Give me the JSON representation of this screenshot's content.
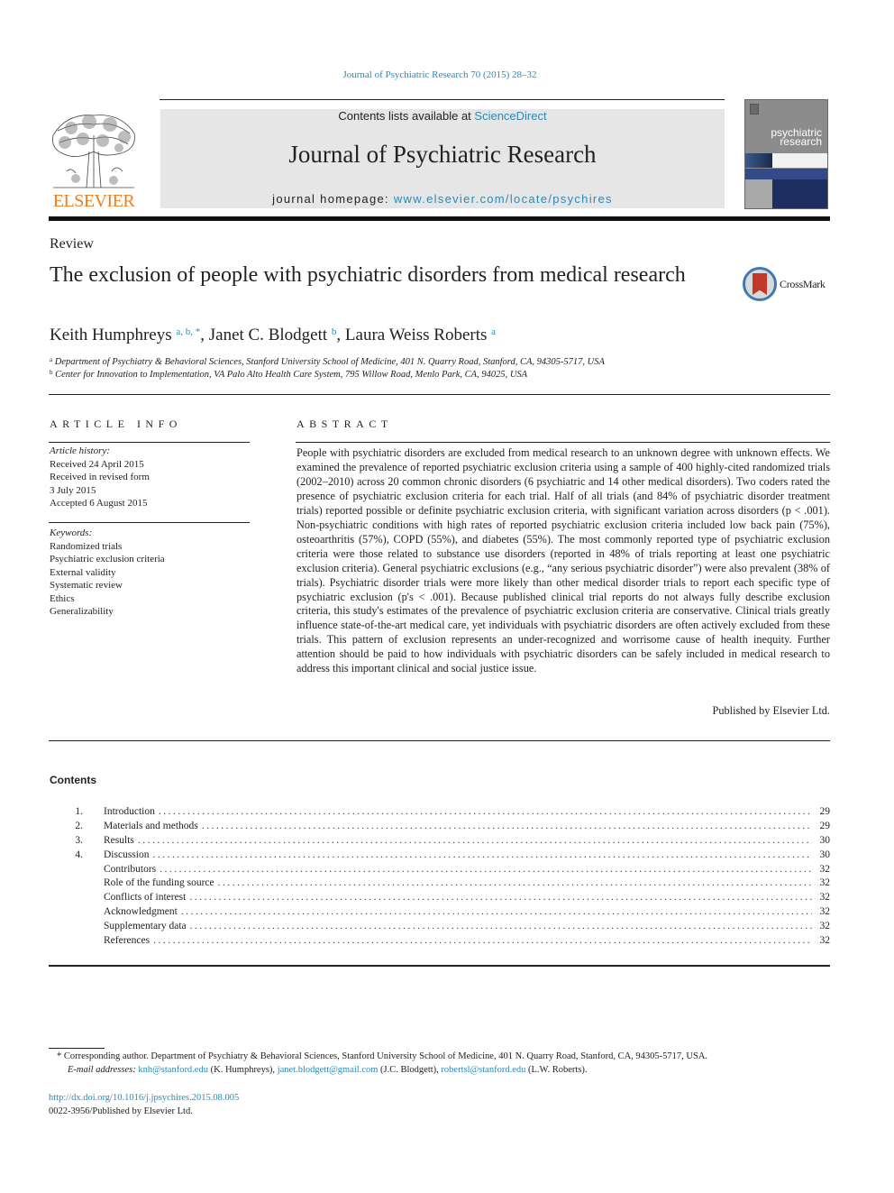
{
  "running_head": "Journal of Psychiatric Research 70 (2015) 28–32",
  "banner": {
    "contents_prefix": "Contents lists available at ",
    "contents_link": "ScienceDirect",
    "journal_name": "Journal of Psychiatric Research",
    "homepage_prefix": "journal homepage: ",
    "homepage_link": "www.elsevier.com/locate/psychires"
  },
  "publisher_logo": "ELSEVIER",
  "cover": {
    "title_line1": "psychiatric",
    "title_line2": "research"
  },
  "crossmark_label": "CrossMark",
  "article_type": "Review",
  "title": "The exclusion of people with psychiatric disorders from medical research",
  "authors": [
    {
      "name": "Keith Humphreys",
      "sup": "a, b, *",
      "sep": ", "
    },
    {
      "name": "Janet C. Blodgett",
      "sup": "b",
      "sep": ", "
    },
    {
      "name": "Laura Weiss Roberts",
      "sup": "a",
      "sep": ""
    }
  ],
  "affiliations": [
    {
      "mark": "a",
      "text": "Department of Psychiatry & Behavioral Sciences, Stanford University School of Medicine, 401 N. Quarry Road, Stanford, CA, 94305-5717, USA"
    },
    {
      "mark": "b",
      "text": "Center for Innovation to Implementation, VA Palo Alto Health Care System, 795 Willow Road, Menlo Park, CA, 94025, USA"
    }
  ],
  "article_info": {
    "heading": "ARTICLE INFO",
    "history_label": "Article history:",
    "history": [
      "Received 24 April 2015",
      "Received in revised form",
      "3 July 2015",
      "Accepted 6 August 2015"
    ],
    "keywords_label": "Keywords:",
    "keywords": [
      "Randomized trials",
      "Psychiatric exclusion criteria",
      "External validity",
      "Systematic review",
      "Ethics",
      "Generalizability"
    ]
  },
  "abstract": {
    "heading": "ABSTRACT",
    "text": "People with psychiatric disorders are excluded from medical research to an unknown degree with unknown effects. We examined the prevalence of reported psychiatric exclusion criteria using a sample of 400 highly-cited randomized trials (2002–2010) across 20 common chronic disorders (6 psychiatric and 14 other medical disorders). Two coders rated the presence of psychiatric exclusion criteria for each trial. Half of all trials (and 84% of psychiatric disorder treatment trials) reported possible or definite psychiatric exclusion criteria, with significant variation across disorders (p < .001). Non-psychiatric conditions with high rates of reported psychiatric exclusion criteria included low back pain (75%), osteoarthritis (57%), COPD (55%), and diabetes (55%). The most commonly reported type of psychiatric exclusion criteria were those related to substance use disorders (reported in 48% of trials reporting at least one psychiatric exclusion criteria). General psychiatric exclusions (e.g., “any serious psychiatric disorder”) were also prevalent (38% of trials). Psychiatric disorder trials were more likely than other medical disorder trials to report each specific type of psychiatric exclusion (p's < .001). Because published clinical trial reports do not always fully describe exclusion criteria, this study's estimates of the prevalence of psychiatric exclusion criteria are conservative. Clinical trials greatly influence state-of-the-art medical care, yet individuals with psychiatric disorders are often actively excluded from these trials. This pattern of exclusion represents an under-recognized and worrisome cause of health inequity. Further attention should be paid to how individuals with psychiatric disorders can be safely included in medical research to address this important clinical and social justice issue.",
    "published_by": "Published by Elsevier Ltd."
  },
  "contents": {
    "heading": "Contents",
    "items": [
      {
        "num": "1.",
        "label": "Introduction",
        "page": "29"
      },
      {
        "num": "2.",
        "label": "Materials and methods",
        "page": "29"
      },
      {
        "num": "3.",
        "label": "Results",
        "page": "30"
      },
      {
        "num": "4.",
        "label": "Discussion",
        "page": "30"
      },
      {
        "num": "",
        "label": "Contributors",
        "page": "32"
      },
      {
        "num": "",
        "label": "Role of the funding source",
        "page": "32"
      },
      {
        "num": "",
        "label": "Conflicts of interest",
        "page": "32"
      },
      {
        "num": "",
        "label": "Acknowledgment",
        "page": "32"
      },
      {
        "num": "",
        "label": "Supplementary data",
        "page": "32"
      },
      {
        "num": "",
        "label": "References",
        "page": "32"
      }
    ]
  },
  "footnote": {
    "corresponding": "* Corresponding author. Department of Psychiatry & Behavioral Sciences, Stanford University School of Medicine, 401 N. Quarry Road, Stanford, CA, 94305-5717, USA.",
    "email_label": "E-mail addresses:",
    "emails": [
      {
        "address": "knh@stanford.edu",
        "who": " (K. Humphreys), "
      },
      {
        "address": "janet.blodgett@gmail.com",
        "who": " (J.C. Blodgett), "
      },
      {
        "address": "robertsl@stanford.edu",
        "who": " (L.W. Roberts)."
      }
    ]
  },
  "doi": "http://dx.doi.org/10.1016/j.jpsychires.2015.08.005",
  "issn_line": "0022-3956/Published by Elsevier Ltd."
}
